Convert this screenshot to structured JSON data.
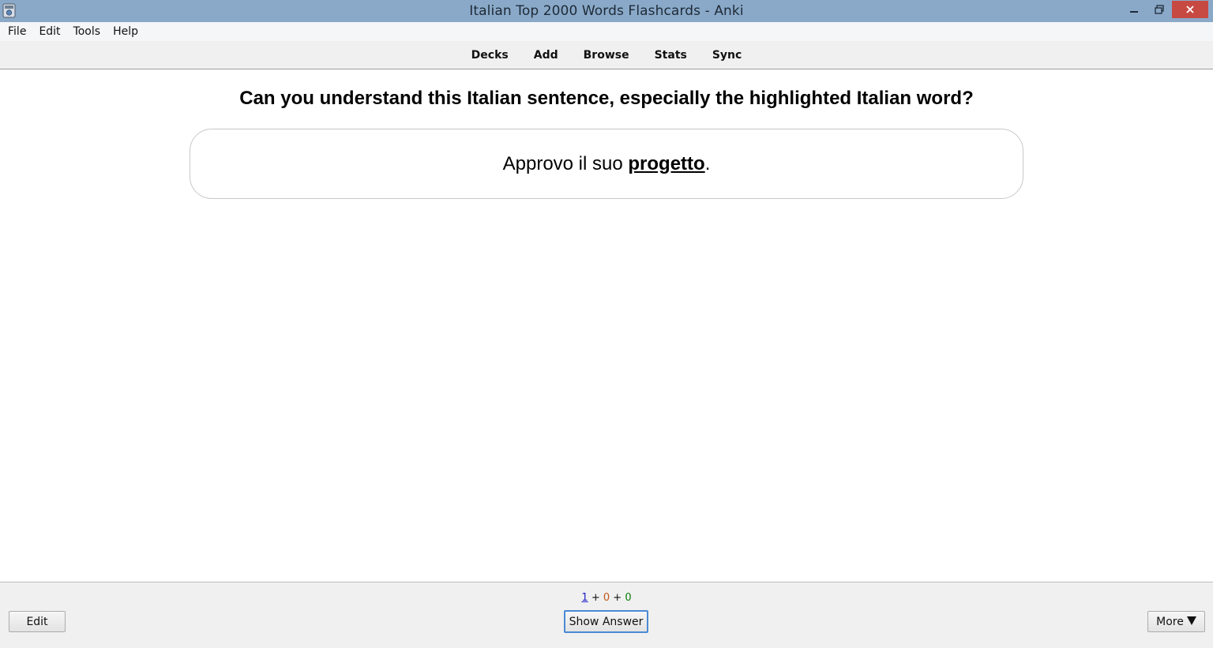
{
  "window": {
    "title": "Italian Top 2000 Words Flashcards - Anki",
    "titlebar_color": "#8aa9c9",
    "close_color": "#c74a42",
    "icons": [
      "anki-app-icon",
      "minimize-icon",
      "restore-icon",
      "close-icon"
    ]
  },
  "menubar": {
    "items": [
      "File",
      "Edit",
      "Tools",
      "Help"
    ]
  },
  "toolbar": {
    "links": [
      "Decks",
      "Add",
      "Browse",
      "Stats",
      "Sync"
    ]
  },
  "card": {
    "question": "Can you understand this Italian sentence, especially the highlighted Italian word?",
    "sentence_before": "Approvo il suo ",
    "highlighted_word": "progetto",
    "sentence_after": "."
  },
  "bottom": {
    "counts": {
      "new": "1",
      "learning": "0",
      "review": "0",
      "separator": "+",
      "colors": {
        "new": "#1e1ec8",
        "learning": "#c35617",
        "review": "#0b7d0b"
      }
    },
    "edit_label": "Edit",
    "show_answer_label": "Show Answer",
    "more_label": "More",
    "more_icon": "triangle-down-icon"
  }
}
